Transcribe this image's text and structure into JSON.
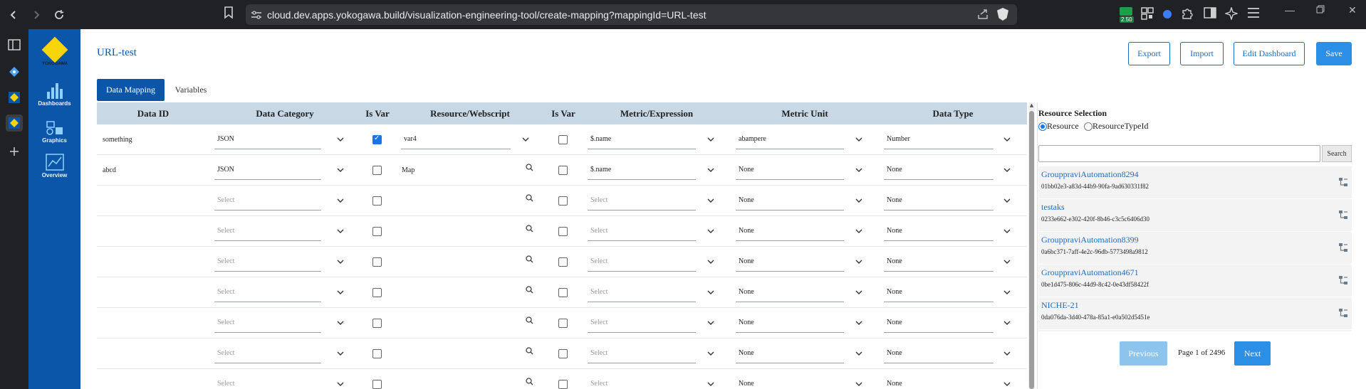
{
  "browser": {
    "url": "cloud.dev.apps.yokogawa.build/visualization-engineering-tool/create-mapping?mappingId=URL-test",
    "extension_badge": "2.50"
  },
  "app": {
    "logo_text": "YOKOGAWA",
    "nav": [
      {
        "label": "Dashboards",
        "icon": "dashboards-icon"
      },
      {
        "label": "Graphics",
        "icon": "graphics-icon"
      },
      {
        "label": "Overview",
        "icon": "overview-icon"
      }
    ]
  },
  "header": {
    "title": "URL-test",
    "buttons": {
      "export": "Export",
      "import": "Import",
      "edit_dashboard": "Edit Dashboard",
      "save": "Save"
    }
  },
  "tabs": {
    "data_mapping": "Data Mapping",
    "variables": "Variables"
  },
  "grid": {
    "columns": [
      "Data ID",
      "Data Category",
      "Is Var",
      "Resource/Webscript",
      "Is Var",
      "Metric/Expression",
      "Metric Unit",
      "Data Type"
    ],
    "rows": [
      {
        "data_id": "something",
        "category": "JSON",
        "is_var1": true,
        "resource": "var4",
        "resource_mode": "dropdown",
        "is_var2": false,
        "metric": "$.name",
        "unit": "abampere",
        "type": "Number"
      },
      {
        "data_id": "abcd",
        "category": "JSON",
        "is_var1": false,
        "resource": "Map",
        "resource_mode": "search",
        "is_var2": false,
        "metric": "$.name",
        "unit": "None",
        "type": "None"
      },
      {
        "data_id": "",
        "category": "Select",
        "is_var1": false,
        "resource": "",
        "resource_mode": "search",
        "is_var2": false,
        "metric": "Select",
        "unit": "None",
        "type": "None"
      },
      {
        "data_id": "",
        "category": "Select",
        "is_var1": false,
        "resource": "",
        "resource_mode": "search",
        "is_var2": false,
        "metric": "Select",
        "unit": "None",
        "type": "None"
      },
      {
        "data_id": "",
        "category": "Select",
        "is_var1": false,
        "resource": "",
        "resource_mode": "search",
        "is_var2": false,
        "metric": "Select",
        "unit": "None",
        "type": "None"
      },
      {
        "data_id": "",
        "category": "Select",
        "is_var1": false,
        "resource": "",
        "resource_mode": "search",
        "is_var2": false,
        "metric": "Select",
        "unit": "None",
        "type": "None"
      },
      {
        "data_id": "",
        "category": "Select",
        "is_var1": false,
        "resource": "",
        "resource_mode": "search",
        "is_var2": false,
        "metric": "Select",
        "unit": "None",
        "type": "None"
      },
      {
        "data_id": "",
        "category": "Select",
        "is_var1": false,
        "resource": "",
        "resource_mode": "search",
        "is_var2": false,
        "metric": "Select",
        "unit": "None",
        "type": "None"
      },
      {
        "data_id": "",
        "category": "Select",
        "is_var1": false,
        "resource": "",
        "resource_mode": "search",
        "is_var2": false,
        "metric": "Select",
        "unit": "None",
        "type": "None"
      }
    ]
  },
  "resource_selection": {
    "title": "Resource Selection",
    "options": {
      "resource": "Resource",
      "resource_type_id": "ResourceTypeId"
    },
    "selected": "resource",
    "search_placeholder": "",
    "search_button": "Search",
    "items": [
      {
        "name": "GrouppraviAutomation8294",
        "id": "01bb02e3-a83d-44b9-90fa-9ad630331f82"
      },
      {
        "name": "testaks",
        "id": "0233e662-e302-420f-8b46-c3c5c6406d30"
      },
      {
        "name": "GrouppraviAutomation8399",
        "id": "0a6bc371-7aff-4e2c-96db-5773498a9812"
      },
      {
        "name": "GrouppraviAutomation4671",
        "id": "0be1d475-806c-44d9-8c42-0e43df58422f"
      },
      {
        "name": "NICHE-21",
        "id": "0da076da-3d40-478a-85a1-e0a502d5451e"
      }
    ],
    "pagination": {
      "previous": "Previous",
      "page_info": "Page 1 of 2496",
      "next": "Next"
    }
  },
  "colors": {
    "nav_bg": "#0c56a9",
    "accent": "#2c8fe6",
    "header_row": "#c8d8e5"
  }
}
